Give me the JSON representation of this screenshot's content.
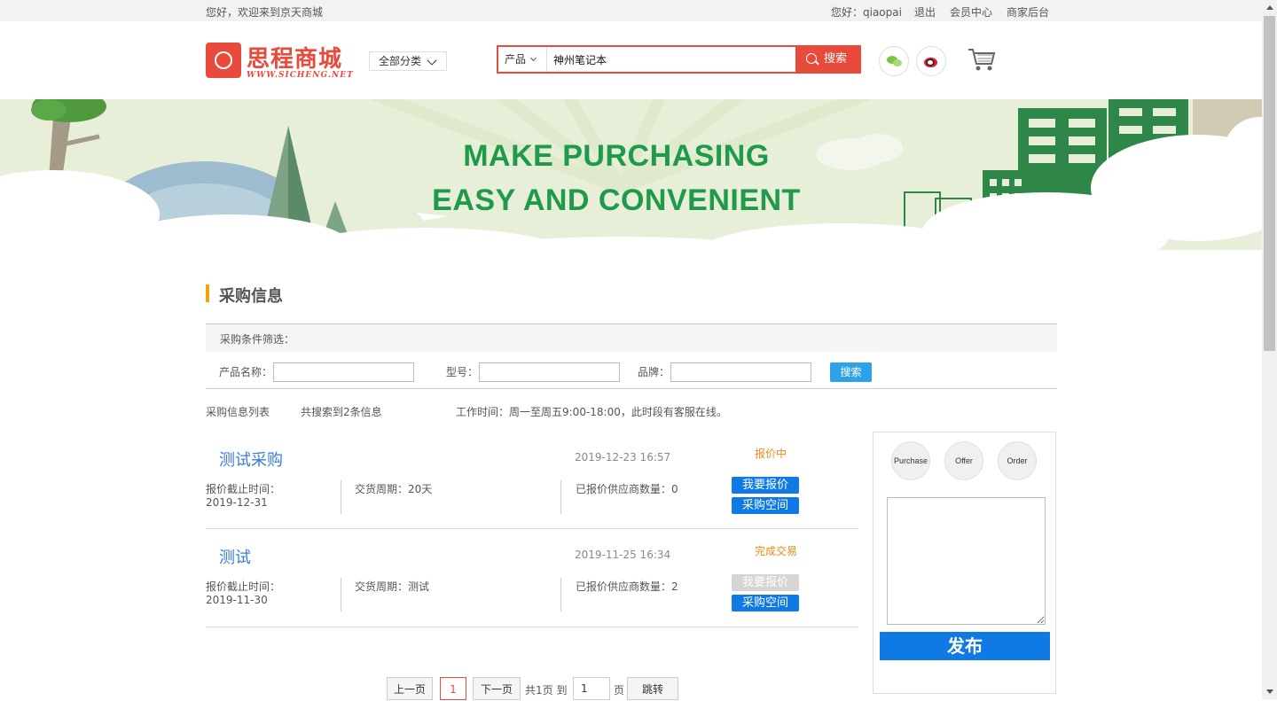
{
  "topbar": {
    "welcome": "您好，欢迎来到京天商城",
    "user_greeting": "您好：qiaopai",
    "logout": "退出",
    "member_center": "会员中心",
    "merchant_backend": "商家后台"
  },
  "header": {
    "logo_text": "思程商城",
    "logo_sub": "WWW.SICHENG.NET",
    "category_button": "全部分类",
    "search_type": "产品",
    "search_value": "神州笔记本",
    "search_button": "搜索",
    "icons": [
      "wechat-icon",
      "weibo-icon",
      "cart-icon"
    ]
  },
  "banner": {
    "line1": "MAKE PURCHASING",
    "line2": "EASY AND CONVENIENT"
  },
  "section": {
    "title": "采购信息",
    "filter_heading": "采购条件筛选：",
    "product_name_label": "产品名称：",
    "model_label": "型号：",
    "brand_label": "品牌：",
    "filter_button": "搜索",
    "list_label": "采购信息列表",
    "result_count": "共搜索到2条信息",
    "work_hours": "工作时间：周一至周五9:00-18:00，此时段有客服在线。"
  },
  "items": [
    {
      "title": "测试采购",
      "date": "2019-12-23 16:57",
      "status": "报价中",
      "deadline_label": "报价截止时间：",
      "deadline": "2019-12-31",
      "delivery": "交货周期：20天",
      "suppliers": "已报价供应商数量：0",
      "quote_button": "我要报价",
      "space_button": "采购空间"
    },
    {
      "title": "测试",
      "date": "2019-11-25 16:34",
      "status": "完成交易",
      "deadline_label": "报价截止时间：",
      "deadline": "2019-11-30",
      "delivery": "交货周期：测试",
      "suppliers": "已报价供应商数量：2",
      "quote_button": "我要报价",
      "space_button": "采购空间"
    }
  ],
  "sidebar": {
    "tabs": [
      "Purchase",
      "Offer",
      "Order"
    ],
    "publish_button": "发布"
  },
  "pagination": {
    "prev": "上一页",
    "current": "1",
    "next": "下一页",
    "total": "共1页 到",
    "goto_value": "1",
    "page_unit": "页",
    "jump": "跳转"
  },
  "colors": {
    "brand_red": "#e84a3c",
    "banner_green": "#1f9a4b",
    "action_blue": "#0f7ae5",
    "status_orange": "#f0891a",
    "section_accent": "#f0a30a"
  }
}
